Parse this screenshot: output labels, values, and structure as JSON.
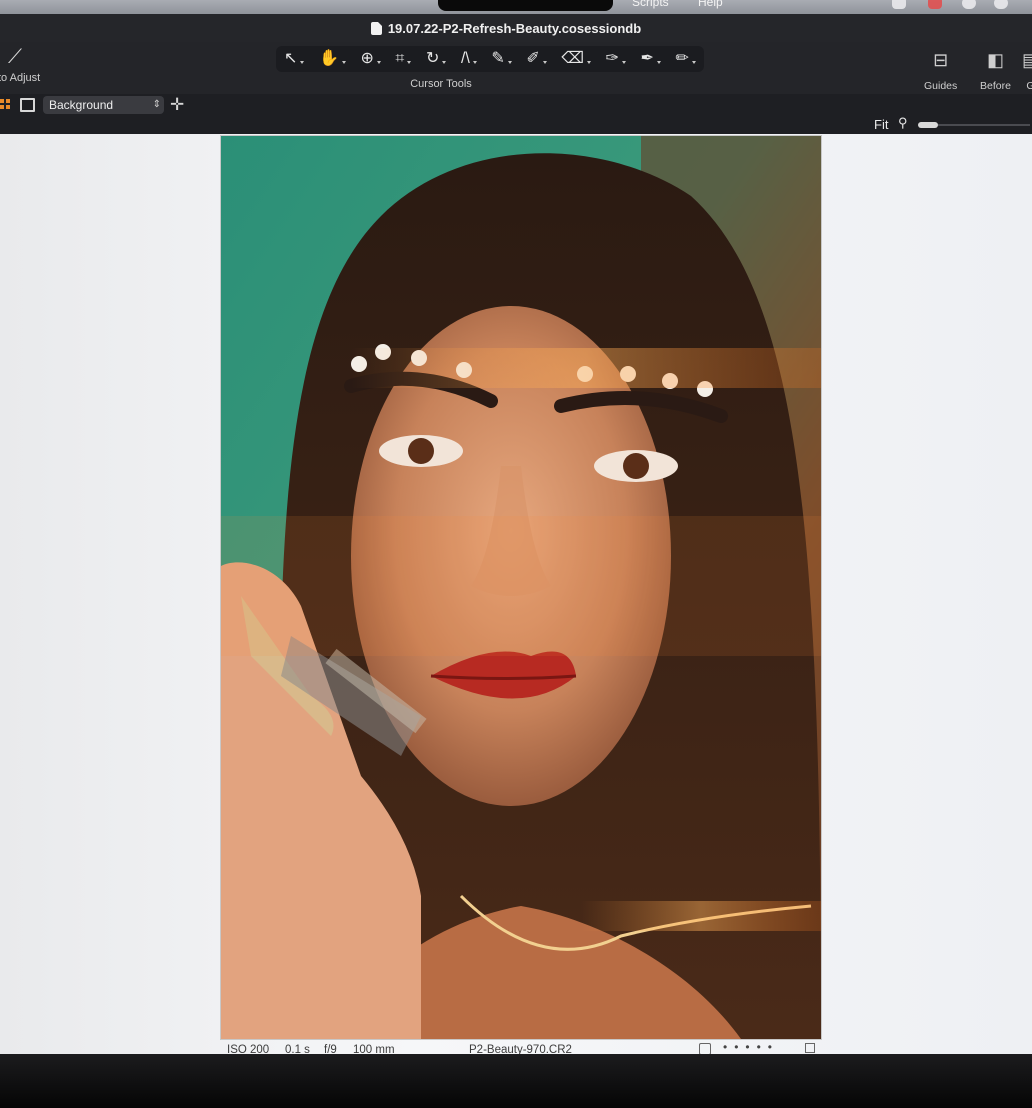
{
  "menubar": {
    "items": [
      "Scripts",
      "Help"
    ]
  },
  "window": {
    "title": "19.07.22-P2-Refresh-Beauty.cosessiondb"
  },
  "toolbar": {
    "auto_adjust_label": "to Adjust",
    "cursor_tools_label": "Cursor Tools",
    "tools": [
      {
        "name": "select-tool",
        "glyph": "↖"
      },
      {
        "name": "pan-tool",
        "glyph": "✋"
      },
      {
        "name": "zoom-tool",
        "glyph": "⊕"
      },
      {
        "name": "crop-tool",
        "glyph": "⌗"
      },
      {
        "name": "rotate-tool",
        "glyph": "↻"
      },
      {
        "name": "keystone-tool",
        "glyph": "/\\"
      },
      {
        "name": "spot-removal-tool",
        "glyph": "✎"
      },
      {
        "name": "brush-tool",
        "glyph": "✐"
      },
      {
        "name": "eraser-tool",
        "glyph": "⌫"
      },
      {
        "name": "gradient-tool",
        "glyph": "✑"
      },
      {
        "name": "picker-tool",
        "glyph": "✒"
      },
      {
        "name": "annotate-tool",
        "glyph": "✏"
      }
    ],
    "guides_label": "Guides",
    "before_label": "Before",
    "extra_label": "G"
  },
  "layers": {
    "selected": "Background"
  },
  "viewer": {
    "zoom_label": "Fit"
  },
  "info": {
    "iso": "ISO 200",
    "shutter": "0.1 s",
    "aperture": "f/9",
    "focal": "100 mm",
    "filename": "P2-Beauty-970.CR2",
    "rating_dots": "•••••"
  }
}
